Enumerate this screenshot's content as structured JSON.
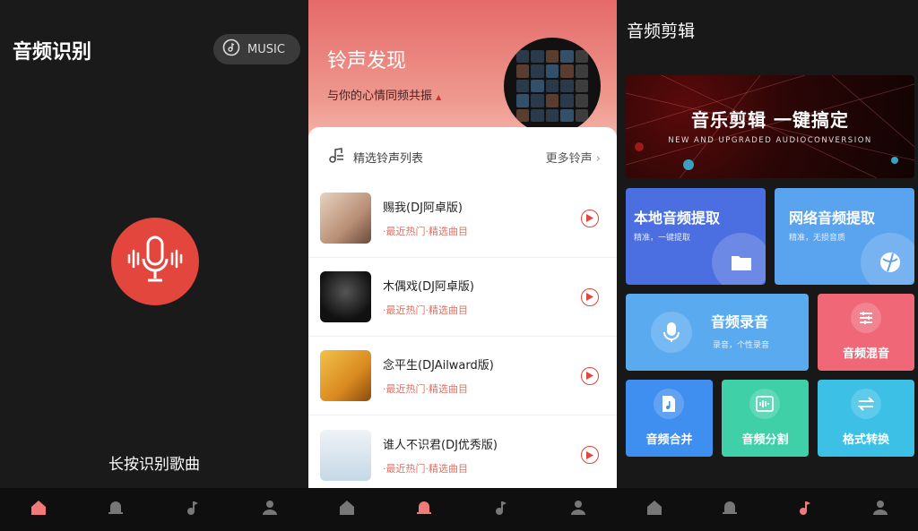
{
  "screen1": {
    "title": "音频识别",
    "music_button": "MUSIC",
    "hint": "长按识别歌曲"
  },
  "screen2": {
    "title": "铃声发现",
    "subtitle": "与你的心情同频共振",
    "list_title": "精选铃声列表",
    "more_label": "更多铃声",
    "songs": [
      {
        "name": "赐我(DJ阿卓版)",
        "tag": "·最近热门·精选曲目",
        "color": "#c9a98f"
      },
      {
        "name": "木偶戏(DJ阿卓版)",
        "tag": "·最近热门·精选曲目",
        "color": "#1a1a1a"
      },
      {
        "name": "念平生(DJAilward版)",
        "tag": "·最近热门·精选曲目",
        "color": "#e1a12f"
      },
      {
        "name": "谁人不识君(DJ优秀版)",
        "tag": "·最近热门·精选曲目",
        "color": "#d6e3ec"
      }
    ]
  },
  "screen3": {
    "title": "音频剪辑",
    "banner_title": "音乐剪辑  一键搞定",
    "banner_sub": "NEW AND UPGRADED AUDIOCONVERSION",
    "tiles": {
      "local": {
        "title": "本地音频提取",
        "sub": "精准，一键提取",
        "color": "#4b6fe0"
      },
      "network": {
        "title": "网络音频提取",
        "sub": "精准，无损音质",
        "color": "#5aa3ee"
      },
      "record": {
        "title": "音频录音",
        "sub": "录音，个性录音",
        "color": "#5aaaf0"
      },
      "mix": {
        "title": "音频混音",
        "color": "#f06878"
      },
      "merge": {
        "title": "音频合并",
        "color": "#3f8ff0"
      },
      "split": {
        "title": "音频分割",
        "color": "#3fd0a8"
      },
      "convert": {
        "title": "格式转换",
        "color": "#3cc0e6"
      }
    }
  },
  "colors": {
    "accent_red": "#e2463d"
  }
}
